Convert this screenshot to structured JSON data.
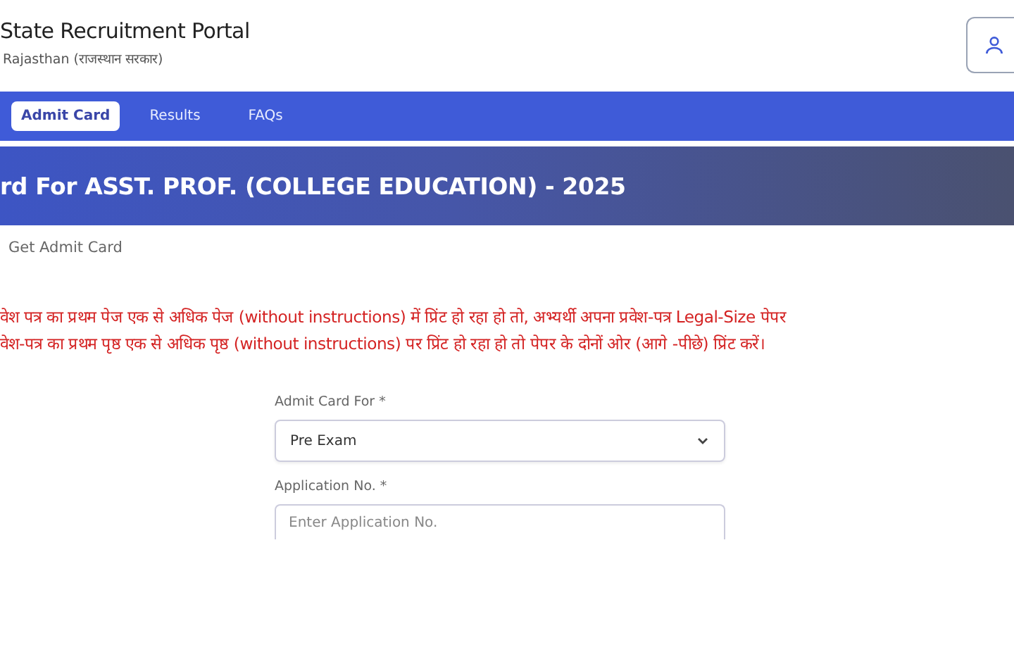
{
  "header": {
    "title": "State Recruitment Portal",
    "subtitle": "Rajasthan (राजस्थान सरकार)"
  },
  "nav": {
    "tabs": [
      {
        "label": "Admit Card",
        "selected": true
      },
      {
        "label": "Results",
        "selected": false
      },
      {
        "label": "FAQs",
        "selected": false
      }
    ]
  },
  "banner": {
    "title": "rd For ASST. PROF. (COLLEGE EDUCATION) - 2025"
  },
  "breadcrumb": "Get Admit Card",
  "notices": [
    "वेश पत्र का प्रथम पेज एक से अधिक पेज (without instructions) में प्रिंट हो रहा हो तो, अभ्यर्थी अपना प्रवेश-पत्र Legal-Size पेपर",
    "वेश-पत्र का प्रथम पृष्ठ एक से अधिक पृष्ठ (without instructions) पर प्रिंट हो रहा हो तो पेपर के दोनों ओर (आगे -पीछे) प्रिंट करें।"
  ],
  "form": {
    "fields": [
      {
        "kind": "select",
        "label": "Admit Card For *",
        "value": "Pre Exam"
      },
      {
        "kind": "text",
        "label": "Application No. *",
        "placeholder": "Enter Application No."
      }
    ]
  }
}
